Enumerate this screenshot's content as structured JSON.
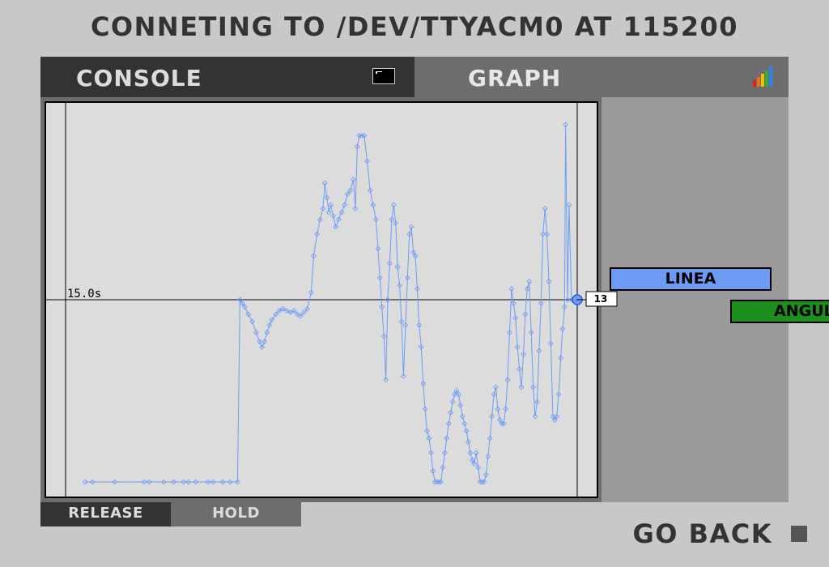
{
  "header": {
    "title": "CONNETING TO /DEV/TTYACM0 AT 115200"
  },
  "tabs": {
    "console_label": "CONSOLE",
    "graph_label": "GRAPH",
    "console_icon": "terminal-icon",
    "graph_icon": "signal-bars-icon"
  },
  "plot": {
    "time_label": "15.0s",
    "current_value": "13",
    "line_color": "#6d9bf5"
  },
  "legend": {
    "linea_label": "LINEA",
    "linea_color": "#6d9bf5",
    "angul_label": "ANGUL",
    "angul_color": "#1d8f1d"
  },
  "controls": {
    "release_label": "RELEASE",
    "hold_label": "HOLD"
  },
  "footer": {
    "go_back_label": "GO BACK"
  },
  "chart_data": {
    "type": "line",
    "series": [
      {
        "name": "LINEA",
        "color": "#6d9bf5",
        "points": [
          [
            0.04,
            0.0
          ],
          [
            0.055,
            0.0
          ],
          [
            0.1,
            0.0
          ],
          [
            0.16,
            0.0
          ],
          [
            0.17,
            0.0
          ],
          [
            0.2,
            0.0
          ],
          [
            0.22,
            0.0
          ],
          [
            0.24,
            0.0
          ],
          [
            0.25,
            0.0
          ],
          [
            0.265,
            0.0
          ],
          [
            0.29,
            0.0
          ],
          [
            0.3,
            0.0
          ],
          [
            0.32,
            0.0
          ],
          [
            0.335,
            0.0
          ],
          [
            0.35,
            0.0
          ],
          [
            0.355,
            0.5
          ],
          [
            0.36,
            0.49
          ],
          [
            0.365,
            0.48
          ],
          [
            0.372,
            0.46
          ],
          [
            0.38,
            0.44
          ],
          [
            0.388,
            0.41
          ],
          [
            0.395,
            0.385
          ],
          [
            0.4,
            0.37
          ],
          [
            0.405,
            0.385
          ],
          [
            0.41,
            0.41
          ],
          [
            0.415,
            0.43
          ],
          [
            0.42,
            0.445
          ],
          [
            0.428,
            0.46
          ],
          [
            0.435,
            0.47
          ],
          [
            0.442,
            0.475
          ],
          [
            0.45,
            0.47
          ],
          [
            0.458,
            0.465
          ],
          [
            0.465,
            0.47
          ],
          [
            0.472,
            0.46
          ],
          [
            0.478,
            0.455
          ],
          [
            0.485,
            0.465
          ],
          [
            0.492,
            0.475
          ],
          [
            0.5,
            0.52
          ],
          [
            0.505,
            0.62
          ],
          [
            0.512,
            0.68
          ],
          [
            0.518,
            0.72
          ],
          [
            0.524,
            0.75
          ],
          [
            0.528,
            0.82
          ],
          [
            0.532,
            0.78
          ],
          [
            0.536,
            0.74
          ],
          [
            0.54,
            0.76
          ],
          [
            0.545,
            0.73
          ],
          [
            0.55,
            0.7
          ],
          [
            0.556,
            0.72
          ],
          [
            0.562,
            0.74
          ],
          [
            0.568,
            0.76
          ],
          [
            0.574,
            0.79
          ],
          [
            0.58,
            0.8
          ],
          [
            0.586,
            0.83
          ],
          [
            0.59,
            0.75
          ],
          [
            0.594,
            0.92
          ],
          [
            0.598,
            0.95
          ],
          [
            0.603,
            0.95
          ],
          [
            0.608,
            0.95
          ],
          [
            0.614,
            0.88
          ],
          [
            0.62,
            0.8
          ],
          [
            0.626,
            0.76
          ],
          [
            0.632,
            0.72
          ],
          [
            0.636,
            0.64
          ],
          [
            0.64,
            0.56
          ],
          [
            0.644,
            0.48
          ],
          [
            0.648,
            0.4
          ],
          [
            0.652,
            0.28
          ],
          [
            0.656,
            0.5
          ],
          [
            0.66,
            0.6
          ],
          [
            0.664,
            0.72
          ],
          [
            0.668,
            0.76
          ],
          [
            0.672,
            0.71
          ],
          [
            0.676,
            0.59
          ],
          [
            0.68,
            0.54
          ],
          [
            0.684,
            0.44
          ],
          [
            0.688,
            0.29
          ],
          [
            0.692,
            0.43
          ],
          [
            0.696,
            0.56
          ],
          [
            0.7,
            0.68
          ],
          [
            0.704,
            0.7
          ],
          [
            0.708,
            0.63
          ],
          [
            0.712,
            0.62
          ],
          [
            0.716,
            0.53
          ],
          [
            0.72,
            0.43
          ],
          [
            0.724,
            0.37
          ],
          [
            0.728,
            0.27
          ],
          [
            0.732,
            0.2
          ],
          [
            0.736,
            0.14
          ],
          [
            0.74,
            0.12
          ],
          [
            0.744,
            0.08
          ],
          [
            0.748,
            0.03
          ],
          [
            0.752,
            0.0
          ],
          [
            0.756,
            0.0
          ],
          [
            0.76,
            0.0
          ],
          [
            0.764,
            0.0
          ],
          [
            0.768,
            0.04
          ],
          [
            0.772,
            0.08
          ],
          [
            0.776,
            0.12
          ],
          [
            0.78,
            0.16
          ],
          [
            0.784,
            0.19
          ],
          [
            0.788,
            0.22
          ],
          [
            0.792,
            0.24
          ],
          [
            0.796,
            0.25
          ],
          [
            0.8,
            0.24
          ],
          [
            0.804,
            0.21
          ],
          [
            0.808,
            0.18
          ],
          [
            0.812,
            0.16
          ],
          [
            0.816,
            0.14
          ],
          [
            0.82,
            0.11
          ],
          [
            0.824,
            0.08
          ],
          [
            0.828,
            0.06
          ],
          [
            0.832,
            0.05
          ],
          [
            0.836,
            0.08
          ],
          [
            0.84,
            0.04
          ],
          [
            0.844,
            0.0
          ],
          [
            0.848,
            0.0
          ],
          [
            0.852,
            0.0
          ],
          [
            0.856,
            0.02
          ],
          [
            0.86,
            0.07
          ],
          [
            0.864,
            0.12
          ],
          [
            0.868,
            0.18
          ],
          [
            0.872,
            0.24
          ],
          [
            0.876,
            0.26
          ],
          [
            0.88,
            0.2
          ],
          [
            0.884,
            0.17
          ],
          [
            0.888,
            0.16
          ],
          [
            0.892,
            0.16
          ],
          [
            0.896,
            0.2
          ],
          [
            0.9,
            0.28
          ],
          [
            0.904,
            0.41
          ],
          [
            0.908,
            0.53
          ],
          [
            0.912,
            0.49
          ],
          [
            0.916,
            0.45
          ],
          [
            0.92,
            0.37
          ],
          [
            0.924,
            0.31
          ],
          [
            0.928,
            0.26
          ],
          [
            0.932,
            0.35
          ],
          [
            0.936,
            0.46
          ],
          [
            0.94,
            0.53
          ],
          [
            0.944,
            0.55
          ],
          [
            0.948,
            0.41
          ],
          [
            0.952,
            0.26
          ],
          [
            0.956,
            0.18
          ],
          [
            0.96,
            0.22
          ],
          [
            0.964,
            0.36
          ],
          [
            0.968,
            0.49
          ],
          [
            0.972,
            0.68
          ],
          [
            0.976,
            0.75
          ],
          [
            0.98,
            0.68
          ],
          [
            0.984,
            0.55
          ],
          [
            0.988,
            0.38
          ],
          [
            0.992,
            0.18
          ],
          [
            0.996,
            0.17
          ],
          [
            1.0,
            0.18
          ],
          [
            1.004,
            0.24
          ],
          [
            1.008,
            0.34
          ],
          [
            1.012,
            0.42
          ],
          [
            1.016,
            0.48
          ],
          [
            1.018,
            0.98
          ],
          [
            1.022,
            0.5
          ],
          [
            1.025,
            0.76
          ],
          [
            1.03,
            0.5
          ]
        ]
      }
    ]
  }
}
